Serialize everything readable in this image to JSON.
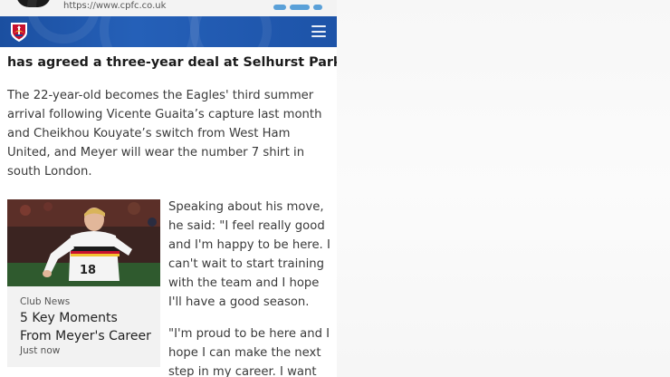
{
  "browser": {
    "url": "https://www.cpfc.co.uk"
  },
  "site_header": {
    "logo": "crystal-palace-crest-icon",
    "menu_icon": "hamburger-menu-icon",
    "brand_color": "#1d55aa"
  },
  "article": {
    "intro_line": "has agreed a three-year deal at Selhurst Park.",
    "paragraph_lines": [
      "The 22-year-old becomes the Eagles' third summer",
      "arrival following Vicente Guaita’s capture last month",
      "and Cheikhou Kouyate’s switch from West Ham",
      "United, and Meyer will wear the number 7 shirt in",
      "south London."
    ],
    "quote_lines": [
      "Speaking about his move,",
      "he said: \"I feel really good",
      "and I'm happy to be here. I",
      "can't wait to start training",
      "with the team and I hope",
      "I'll have a good season.",
      "",
      "\"I'm proud to be here and I",
      "hope I can make the next",
      "step in my career. I want"
    ]
  },
  "related_card": {
    "category": "Club News",
    "title_lines": [
      "5 Key Moments",
      "From Meyer's Career"
    ],
    "time": "Just now",
    "image_alt": "player in white Germany shirt number 18"
  }
}
